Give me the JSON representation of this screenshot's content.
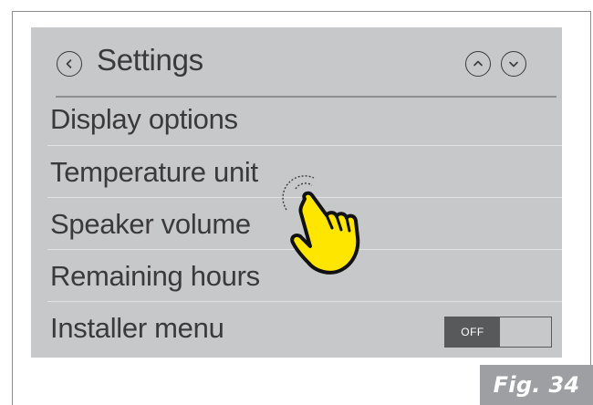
{
  "header": {
    "title": "Settings",
    "back_icon": "chevron-left-icon",
    "up_icon": "chevron-up-icon",
    "down_icon": "chevron-down-icon"
  },
  "menu": {
    "items": [
      {
        "label": "Display options"
      },
      {
        "label": "Temperature unit"
      },
      {
        "label": "Speaker volume"
      },
      {
        "label": "Remaining hours"
      },
      {
        "label": "Installer menu",
        "toggle": {
          "state_label": "OFF",
          "on": false
        }
      }
    ]
  },
  "overlay": {
    "icon": "tap-hand-icon",
    "hand_color": "#ffe600"
  },
  "figure": {
    "label": "Fig. 34"
  },
  "colors": {
    "screen_bg": "#c7c8ca",
    "text": "#3a3a3c",
    "toggle_knob": "#58595b",
    "fig_badge": "#9d9fa2"
  }
}
